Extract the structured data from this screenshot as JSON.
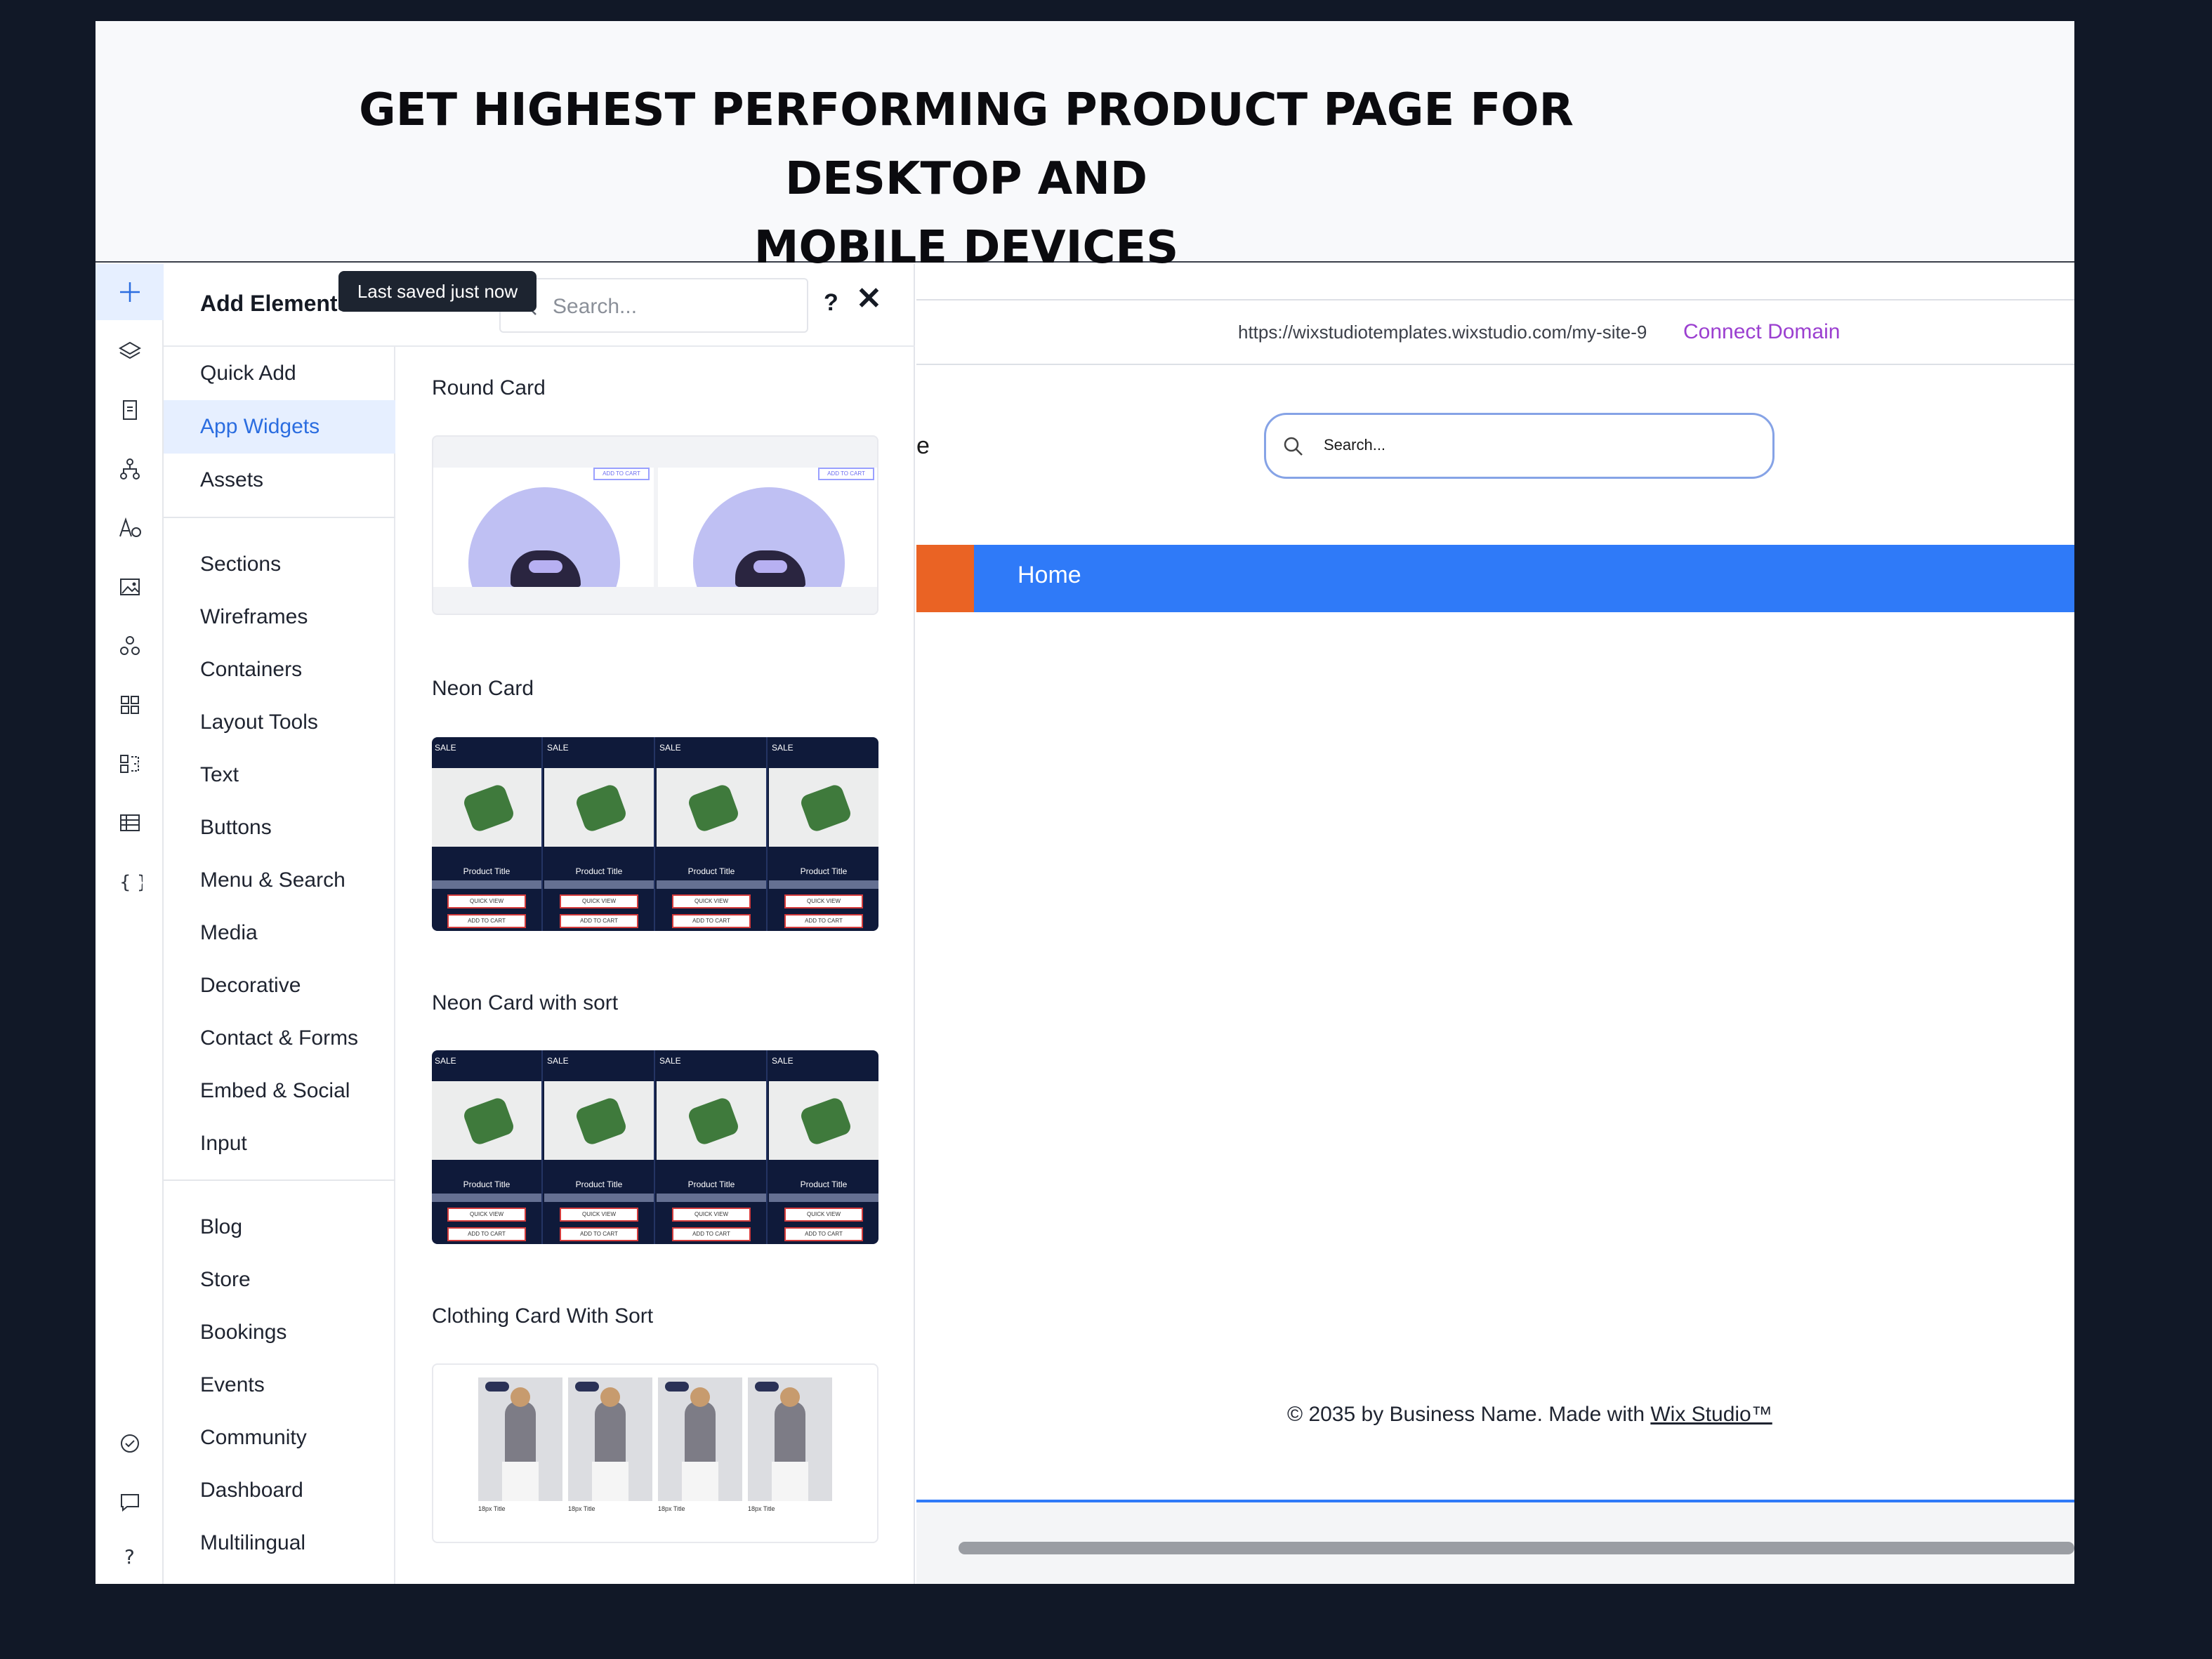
{
  "banner": {
    "title_line1": "GET HIGHEST PERFORMING PRODUCT PAGE FOR DESKTOP AND",
    "title_line2": "MOBILE DEVICES"
  },
  "rail": {
    "icons": [
      "plus-icon",
      "layers-icon",
      "page-icon",
      "sitemap-icon",
      "typography-icon",
      "image-icon",
      "apps-icon",
      "grid-icon",
      "components-icon",
      "table-icon",
      "code-icon",
      "check-circle-icon",
      "chat-icon",
      "help-icon"
    ]
  },
  "panel": {
    "title": "Add Elements",
    "tooltip": "Last saved just now",
    "search_placeholder": "Search...",
    "help_label": "?",
    "close_label": "✕",
    "categories_top": [
      "Quick Add",
      "App Widgets",
      "Assets"
    ],
    "categories_mid": [
      "Sections",
      "Wireframes",
      "Containers",
      "Layout Tools",
      "Text",
      "Buttons",
      "Menu & Search",
      "Media",
      "Decorative",
      "Contact & Forms",
      "Embed & Social",
      "Input"
    ],
    "categories_bottom": [
      "Blog",
      "Store",
      "Bookings",
      "Events",
      "Community",
      "Dashboard",
      "Multilingual"
    ],
    "active_category": "App Widgets",
    "sections": [
      {
        "label": "Round Card"
      },
      {
        "label": "Neon Card"
      },
      {
        "label": "Neon Card with sort"
      },
      {
        "label": "Clothing Card With Sort"
      }
    ],
    "round_card": {
      "button": "ADD TO CART"
    },
    "neon_card": {
      "sale": "SALE",
      "title": "Product Title",
      "quick_view": "QUICK VIEW",
      "add_to_cart": "ADD TO CART"
    },
    "clothing_card": {
      "caption": "18px Title"
    }
  },
  "preview": {
    "url": "https://wixstudiotemplates.wixstudio.com/my-site-9",
    "connect_domain": "Connect Domain",
    "logo_partial": "e",
    "search_placeholder": "Search...",
    "nav_home": "Home",
    "footer_prefix": "© 2035 by Business Name. Made with ",
    "footer_link": "Wix Studio™"
  },
  "colors": {
    "accent": "#2b6de0",
    "nav_blue": "#2f7af8",
    "orange": "#ea6324",
    "connect": "#9b3fd0",
    "background": "#111827"
  }
}
